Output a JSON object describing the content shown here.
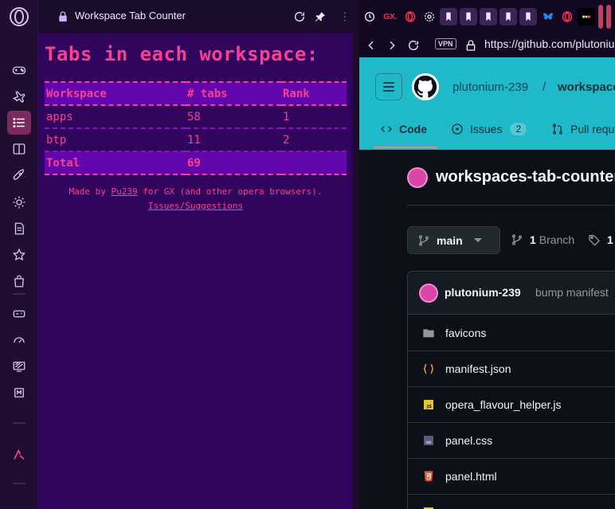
{
  "panel": {
    "header_title": "Workspace Tab Counter",
    "heading": "Tabs in each workspace:",
    "table": {
      "headers": [
        "Workspace",
        "# tabs",
        "Rank"
      ],
      "rows": [
        {
          "workspace": "apps",
          "tabs": "58",
          "rank": "1"
        },
        {
          "workspace": "btp",
          "tabs": "11",
          "rank": "2"
        }
      ],
      "total_label": "Total",
      "total_value": "69"
    },
    "footer": {
      "made_by": "Made by",
      "author_link": "Pu239",
      "made_by_suffix": "for GX (and other opera browsers).",
      "issues_link": "Issues/Suggestions"
    },
    "accent_color": "#ff3f8e",
    "background_color": "#30055e"
  },
  "sidebar": {
    "items": [
      "gamepad-icon",
      "airplane-icon",
      "list-icon",
      "book-icon",
      "rocket-icon",
      "sun-icon",
      "notes-icon",
      "star-icon",
      "bag-icon",
      "controller-icon",
      "speedometer-icon",
      "monitor-icon",
      "chip-icon",
      "aria-icon"
    ]
  },
  "browser": {
    "vpn_label": "VPN",
    "url": "https://github.com/plutoniu",
    "tabs": [
      "clock-icon",
      "gx-corner-icon",
      "opera-icon",
      "gear-icon",
      "bookmark-icon",
      "bookmark-icon",
      "bookmark-icon",
      "bookmark-icon",
      "bookmark-icon",
      "bookmark-icon",
      "bluesky-icon",
      "opera-icon",
      "dots-icon"
    ],
    "gx_label": "GX."
  },
  "github": {
    "owner": "plutonium-239",
    "separator": "/",
    "repo": "workspaces-tab-counter",
    "nav": {
      "code": "Code",
      "issues": "Issues",
      "issues_count": "2",
      "pull_requests": "Pull requests"
    },
    "repo_title": "workspaces-tab-counter",
    "branch": "main",
    "branch_count": "1",
    "branch_label": "Branch",
    "tag_count": "1",
    "commit": {
      "author": "plutonium-239",
      "message": "bump manifest"
    },
    "files": [
      {
        "name": "favicons",
        "icon": "folder-icon"
      },
      {
        "name": "manifest.json",
        "icon": "json-icon"
      },
      {
        "name": "opera_flavour_helper.js",
        "icon": "js-icon"
      },
      {
        "name": "panel.css",
        "icon": "css-icon"
      },
      {
        "name": "panel.html",
        "icon": "html-icon"
      }
    ],
    "header_color": "#1fbac9"
  }
}
